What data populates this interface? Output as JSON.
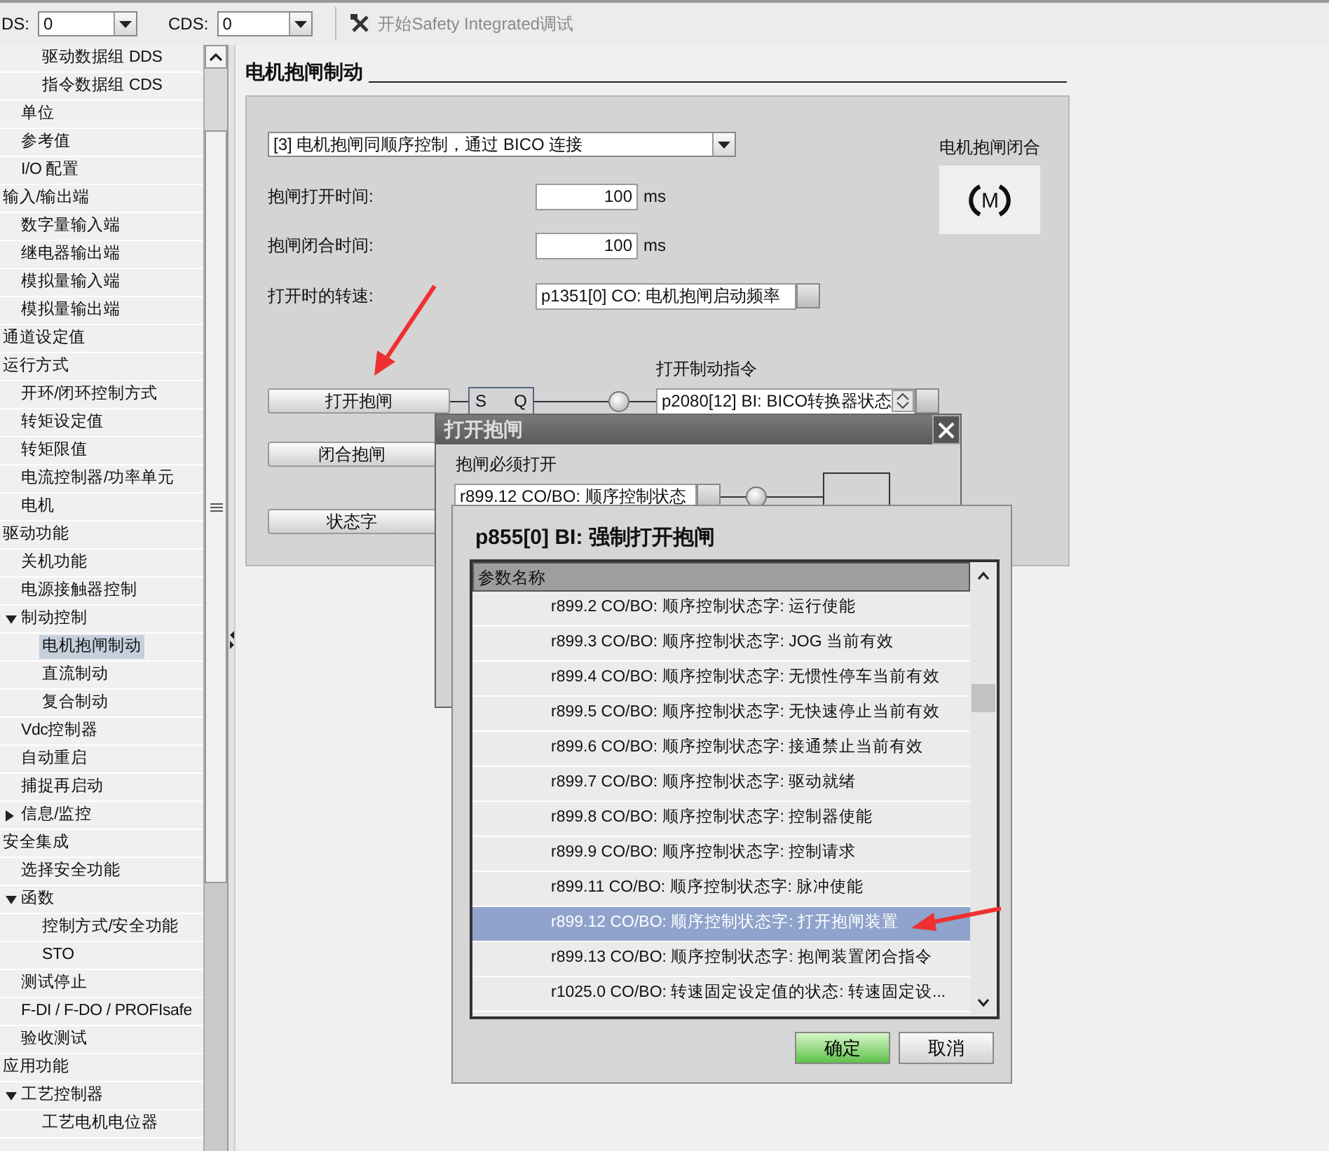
{
  "toolbar": {
    "dds_label": "DS:",
    "dds_value": "0",
    "cds_label": "CDS:",
    "cds_value": "0",
    "safety_button": {
      "label": "开始Safety Integrated调试",
      "disabled": true
    }
  },
  "tree": [
    {
      "children": [
        {
          "children": [
            {
              "label": "驱动数据组 DDS",
              "selected": false
            },
            {
              "label": "指令数据组 CDS",
              "selected": false
            }
          ]
        },
        {
          "label": "单位",
          "selected": false
        },
        {
          "label": "参考值",
          "selected": false
        },
        {
          "label": "I/O 配置",
          "selected": false
        }
      ]
    },
    {
      "label": "输入/输出端",
      "selected": false,
      "children": [
        {
          "label": "数字量输入端",
          "selected": false
        },
        {
          "label": "继电器输出端",
          "selected": false
        },
        {
          "label": "模拟量输入端",
          "selected": false
        },
        {
          "label": "模拟量输出端",
          "selected": false
        }
      ]
    },
    {
      "label": "通道设定值",
      "selected": false
    },
    {
      "label": "运行方式",
      "selected": false,
      "children": [
        {
          "label": "开环/闭环控制方式",
          "selected": false
        },
        {
          "label": "转矩设定值",
          "selected": false
        },
        {
          "label": "转矩限值",
          "selected": false
        },
        {
          "label": "电流控制器/功率单元",
          "selected": false
        },
        {
          "label": "电机",
          "selected": false
        }
      ]
    },
    {
      "label": "驱动功能",
      "selected": false,
      "children": [
        {
          "label": "关机功能",
          "selected": false
        },
        {
          "label": "电源接触器控制",
          "selected": false
        },
        {
          "label": "制动控制",
          "selected": false,
          "expanded": true,
          "children": [
            {
              "label": "电机抱闸制动",
              "selected": true
            },
            {
              "label": "直流制动",
              "selected": false
            },
            {
              "label": "复合制动",
              "selected": false
            }
          ]
        },
        {
          "label": "Vdc控制器",
          "selected": false
        },
        {
          "label": "自动重启",
          "selected": false
        },
        {
          "label": "捕捉再启动",
          "selected": false
        },
        {
          "label": "信息/监控",
          "selected": false,
          "expanded": false
        }
      ]
    },
    {
      "label": "安全集成",
      "selected": false,
      "children": [
        {
          "label": "选择安全功能",
          "selected": false
        },
        {
          "label": "函数",
          "selected": false,
          "expanded": true,
          "children": [
            {
              "label": "控制方式/安全功能",
              "selected": false
            },
            {
              "label": "STO",
              "selected": false
            }
          ]
        },
        {
          "label": "测试停止",
          "selected": false
        },
        {
          "label": "F-DI / F-DO / PROFIsafe",
          "selected": false
        },
        {
          "label": "验收测试",
          "selected": false
        }
      ]
    },
    {
      "label": "应用功能",
      "selected": false,
      "children": [
        {
          "label": "工艺控制器",
          "selected": false,
          "expanded": true,
          "children": [
            {
              "label": "工艺电机电位器",
              "selected": false
            }
          ]
        }
      ]
    }
  ],
  "page": {
    "title": "电机抱闸制动",
    "mode": "[3] 电机抱闸同顺序控制，通过 BICO 连接",
    "fields": [
      {
        "label": "抱闸打开时间:",
        "value": "100",
        "unit": "ms",
        "kind": "number"
      },
      {
        "label": "抱闸闭合时间:",
        "value": "100",
        "unit": "ms",
        "kind": "number"
      },
      {
        "label": "打开时的转速:",
        "value": "p1351[0] CO: 电机抱闸启动频率",
        "kind": "signal"
      }
    ],
    "status_label": "电机抱闸闭合",
    "motor_symbol": "M",
    "buttons": [
      "打开抱闸",
      "闭合抱闸",
      "状态字"
    ],
    "flipflop": {
      "set": "S",
      "output": "Q"
    },
    "output_label": "打开制动指令",
    "output_value": "p2080[12] BI: BICO转换器状态"
  },
  "dialog_open": {
    "title": "打开抱闸",
    "label": "抱闸必须打开",
    "value": "r899.12 CO/BO: 顺序控制状态"
  },
  "dialog_select": {
    "title": "p855[0] BI: 强制打开抱闸",
    "column": "参数名称",
    "rows": [
      {
        "text": "r899.2 CO/BO: 顺序控制状态字: 运行使能",
        "selected": false
      },
      {
        "text": "r899.3 CO/BO: 顺序控制状态字: JOG 当前有效",
        "selected": false
      },
      {
        "text": "r899.4 CO/BO: 顺序控制状态字: 无惯性停车当前有效",
        "selected": false
      },
      {
        "text": "r899.5 CO/BO: 顺序控制状态字: 无快速停止当前有效",
        "selected": false
      },
      {
        "text": "r899.6 CO/BO: 顺序控制状态字: 接通禁止当前有效",
        "selected": false
      },
      {
        "text": "r899.7 CO/BO: 顺序控制状态字: 驱动就绪",
        "selected": false
      },
      {
        "text": "r899.8 CO/BO: 顺序控制状态字: 控制器使能",
        "selected": false
      },
      {
        "text": "r899.9 CO/BO: 顺序控制状态字: 控制请求",
        "selected": false
      },
      {
        "text": "r899.11 CO/BO: 顺序控制状态字: 脉冲使能",
        "selected": false
      },
      {
        "text": "r899.12 CO/BO: 顺序控制状态字: 打开抱闸装置",
        "selected": true
      },
      {
        "text": "r899.13 CO/BO: 顺序控制状态字: 抱闸装置闭合指令",
        "selected": false
      },
      {
        "text": "r1025.0 CO/BO: 转速固定设定值的状态: 转速固定设...",
        "selected": false
      }
    ],
    "ok": "确定",
    "cancel": "取消"
  }
}
